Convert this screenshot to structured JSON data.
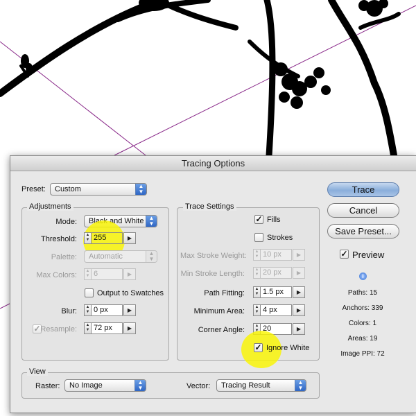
{
  "dialog": {
    "title": "Tracing Options",
    "preset": {
      "label": "Preset:",
      "value": "Custom"
    },
    "adjustments": {
      "title": "Adjustments",
      "mode": {
        "label": "Mode:",
        "value": "Black and White"
      },
      "threshold": {
        "label": "Threshold:",
        "value": "255"
      },
      "palette": {
        "label": "Palette:",
        "value": "Automatic",
        "enabled": false
      },
      "max_colors": {
        "label": "Max Colors:",
        "value": "6",
        "enabled": false
      },
      "output_to_swatches": {
        "label": "Output to Swatches",
        "checked": false
      },
      "blur": {
        "label": "Blur:",
        "value": "0 px"
      },
      "resample": {
        "label": "Resample:",
        "value": "72 px",
        "checked": true,
        "enabled": false
      }
    },
    "trace_settings": {
      "title": "Trace Settings",
      "fills": {
        "label": "Fills",
        "checked": true
      },
      "strokes": {
        "label": "Strokes",
        "checked": false
      },
      "max_stroke_weight": {
        "label": "Max Stroke Weight:",
        "value": "10 px",
        "enabled": false
      },
      "min_stroke_length": {
        "label": "Min Stroke Length:",
        "value": "20 px",
        "enabled": false
      },
      "path_fitting": {
        "label": "Path Fitting:",
        "value": "1.5 px"
      },
      "minimum_area": {
        "label": "Minimum Area:",
        "value": "4 px"
      },
      "corner_angle": {
        "label": "Corner Angle:",
        "value": "20"
      },
      "ignore_white": {
        "label": "Ignore White",
        "checked": true
      }
    },
    "view": {
      "title": "View",
      "raster": {
        "label": "Raster:",
        "value": "No Image"
      },
      "vector": {
        "label": "Vector:",
        "value": "Tracing Result"
      }
    },
    "buttons": {
      "trace": "Trace",
      "cancel": "Cancel",
      "save_preset": "Save Preset..."
    },
    "preview": {
      "label": "Preview",
      "checked": true
    },
    "stats": {
      "paths": "Paths: 15",
      "anchors": "Anchors: 339",
      "colors": "Colors: 1",
      "areas": "Areas: 19",
      "image_ppi": "Image PPI: 72"
    },
    "icons": {
      "checkmark": "✓",
      "dropdown_arrow": "▶",
      "spin_up": "▲",
      "spin_down": "▼",
      "info": "i"
    },
    "highlight_color": "#f7f300"
  }
}
